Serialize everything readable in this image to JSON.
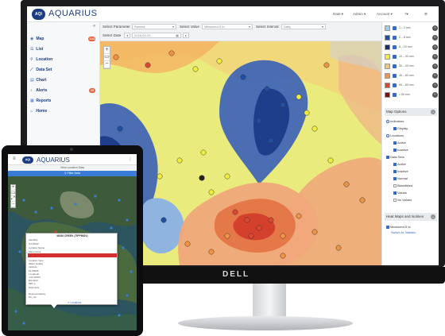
{
  "desktop": {
    "app_title": "AQUARIUS",
    "logo_badge": "AQI",
    "header_menus": [
      "Data ▾",
      "Admin ▾",
      "Account ▾",
      "?▾",
      "⚙"
    ],
    "sidebar": {
      "collapse": "«",
      "items": [
        {
          "label": "Map",
          "icon": "globe-icon",
          "badge": "144"
        },
        {
          "label": "List",
          "icon": "list-icon",
          "badge": ""
        },
        {
          "label": "Location",
          "icon": "map-marker-icon",
          "badge": ""
        },
        {
          "label": "Data Set",
          "icon": "line-chart-icon",
          "badge": ""
        },
        {
          "label": "Chart",
          "icon": "chart-icon",
          "badge": ""
        },
        {
          "label": "Alerts",
          "icon": "bell-icon",
          "badge": "15"
        },
        {
          "label": "Reports",
          "icon": "document-icon",
          "badge": ""
        },
        {
          "label": "Home",
          "icon": "home-icon",
          "badge": ""
        }
      ]
    },
    "toolbar": {
      "parameter_label": "Select Parameter",
      "parameter_value": "Rainfall",
      "value_label": "Select Value",
      "value_value": "Measured 5 hr",
      "interval_label": "Select Interval",
      "interval_value": "Daily",
      "date_label": "Select Date",
      "date_value": "2016-02-22",
      "prev": "◂",
      "next": "▸",
      "calendar": "▦"
    },
    "map": {
      "zoom_in": "+",
      "zoom_out": "−"
    },
    "legend": [
      {
        "color": "#9ecbe8",
        "label": "1 – 2 mm",
        "count": "0"
      },
      {
        "color": "#1e4fa8",
        "label": "2 – 8 mm",
        "count": "0"
      },
      {
        "color": "#152f6b",
        "label": "8 – 10 mm",
        "count": "0"
      },
      {
        "color": "#f2ee3c",
        "label": "10 – 30 mm",
        "count": "0"
      },
      {
        "color": "#f5c27a",
        "label": "30 – 40 mm",
        "count": "0"
      },
      {
        "color": "#f39440",
        "label": "40 – 60 mm",
        "count": "0"
      },
      {
        "color": "#e0452f",
        "label": "60 – 80 mm",
        "count": "0"
      },
      {
        "color": "#7a1010",
        "label": "> 80 mm",
        "count": "0"
      }
    ],
    "map_options": {
      "title": "Map Options",
      "chevron": "⌄",
      "items": [
        {
          "label": "Indicators",
          "checked": "radio",
          "indent": 0
        },
        {
          "label": "Display",
          "checked": "yes",
          "indent": 1
        },
        {
          "label": "Locations",
          "checked": "radio",
          "indent": 0
        },
        {
          "label": "Active",
          "checked": "yes",
          "indent": 1
        },
        {
          "label": "Inactive",
          "checked": "yes",
          "indent": 1
        },
        {
          "label": "Data Sets",
          "checked": "check",
          "indent": 0
        },
        {
          "label": "Active",
          "checked": "yes",
          "indent": 1
        },
        {
          "label": "Inactive",
          "checked": "yes",
          "indent": 1
        },
        {
          "label": "Normal",
          "checked": "yes",
          "indent": 1
        },
        {
          "label": "Blacklisted",
          "checked": "no",
          "indent": 1
        },
        {
          "label": "Values",
          "checked": "yes",
          "indent": 1
        },
        {
          "label": "No Values",
          "checked": "no",
          "indent": 1
        }
      ]
    },
    "heat_maps": {
      "title": "Heat Maps and Isolines",
      "chevron": "⌄",
      "option": "Measured 5 hr",
      "link": "Switch to Statistic"
    }
  },
  "monitor_brand": "DELL",
  "tablet": {
    "app_title": "AQUARIUS",
    "logo_badge": "AQI",
    "menu": "≡",
    "kebab": "⋮",
    "subheader": "View Location Data",
    "filter_button": "⚲ Filter Data",
    "zoom_in": "+",
    "zoom_out": "−",
    "popup": {
      "title": "MAIN CREEK (TIPPINSV)",
      "lines": [
        "Identifier",
        "GA70032",
        "Location Name",
        "Main Creek"
      ],
      "highlight": "Measured 5 hr Rainfall: 8.3 mm",
      "lines_after": [
        "Location Type",
        "Water Quality",
        "Latitude",
        "51.28405",
        "Longitude",
        "-119.46872",
        "Elevation",
        "990 m",
        "Data Sets",
        "",
        "Representativity",
        "No_cal"
      ],
      "close": "✕ Locations"
    }
  },
  "colors": {
    "brand": "#1b3d86",
    "accent": "#3a68c5",
    "badge": "#e5603a"
  }
}
